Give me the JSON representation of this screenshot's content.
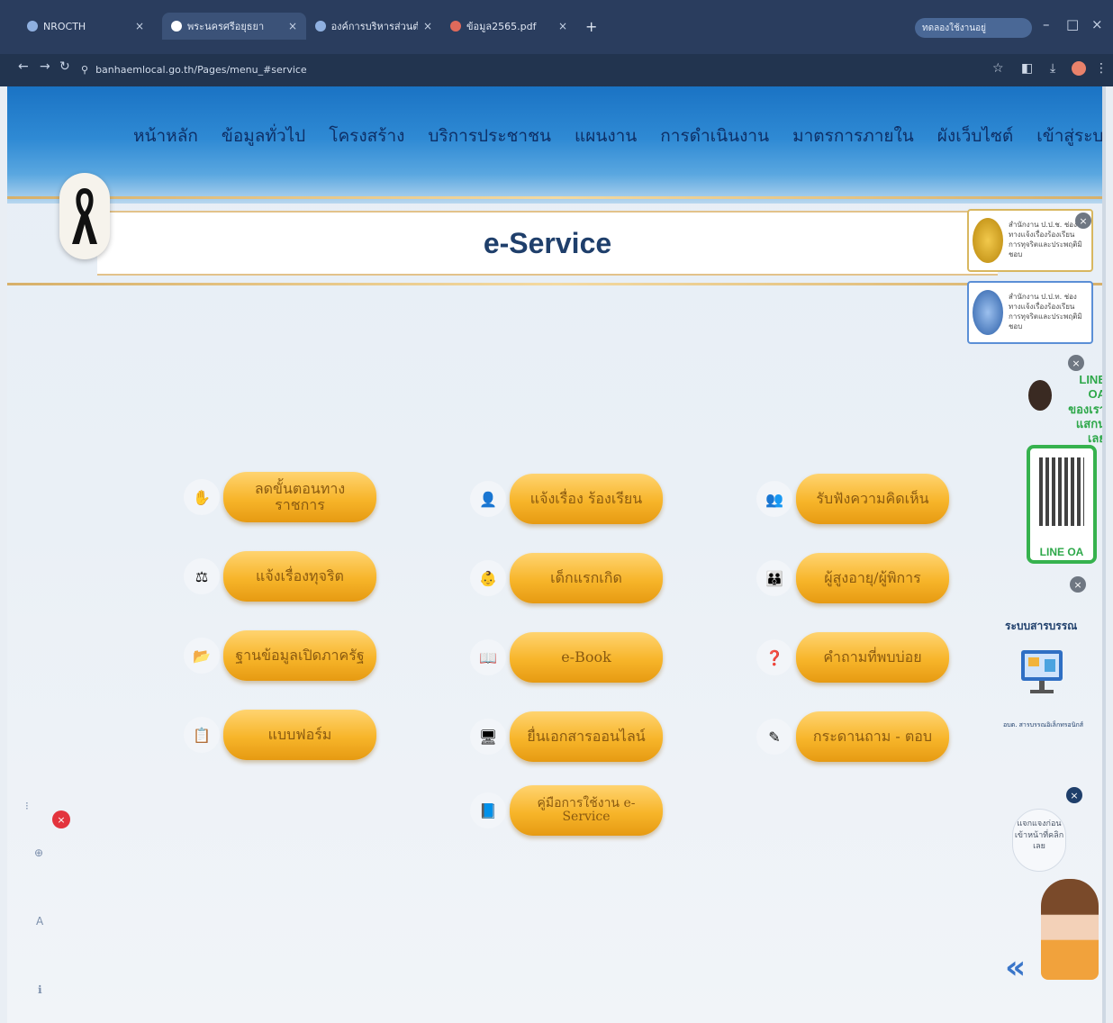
{
  "browser": {
    "tabs": [
      {
        "label": "NROCTH"
      },
      {
        "label": "พระนครศรีอยุธยา"
      },
      {
        "label": "องค์การบริหารส่วนตำบลบ้านแหลม"
      },
      {
        "label": "ข้อมูล2565.pdf"
      }
    ],
    "new_tab": "+",
    "profile_chip": "ทดลองใช้งานอยู่",
    "url": "banhaemlocal.go.th/Pages/menu_#service",
    "window_controls": {
      "minimize": "–",
      "maximize": "□",
      "close": "×"
    }
  },
  "nav": {
    "items": [
      "หน้าหลัก",
      "ข้อมูลทั่วไป",
      "โครงสร้าง",
      "บริการประชาชน",
      "แผนงาน",
      "การดำเนินงาน",
      "มาตรการภายใน",
      "ผังเว็บไซต์",
      "เข้าสู่ระบบ"
    ]
  },
  "page": {
    "title": "e-Service"
  },
  "services": {
    "col1": [
      {
        "label": "ลดขั้นตอนทางราชการ",
        "icon": "hands-icon"
      },
      {
        "label": "แจ้งเรื่องทุจริต",
        "icon": "scale-icon"
      },
      {
        "label": "ฐานข้อมูลเปิดภาครัฐ",
        "icon": "folder-icon"
      },
      {
        "label": "แบบฟอร์ม",
        "icon": "clipboard-icon"
      }
    ],
    "col2": [
      {
        "label": "แจ้งเรื่อง ร้องเรียน",
        "icon": "person-icon"
      },
      {
        "label": "เด็กแรกเกิด",
        "icon": "baby-icon"
      },
      {
        "label": "e-Book",
        "icon": "book-icon"
      },
      {
        "label": "ยื่นเอกสารออนไลน์",
        "icon": "monitor-icon"
      },
      {
        "label": "คู่มือการใช้งาน e-Service",
        "icon": "manual-icon"
      }
    ],
    "col3": [
      {
        "label": "รับฟังความคิดเห็น",
        "icon": "meeting-icon"
      },
      {
        "label": "ผู้สูงอายุ/ผู้พิการ",
        "icon": "family-icon"
      },
      {
        "label": "คำถามที่พบบ่อย",
        "icon": "faq-icon"
      },
      {
        "label": "กระดานถาม - ตอบ",
        "icon": "qa-icon"
      }
    ]
  },
  "side": {
    "card1": {
      "text": "สำนักงาน ป.ป.ช. ช่องทางแจ้งเรื่องร้องเรียน การทุจริตและประพฤติมิชอบ"
    },
    "card2": {
      "text": "สำนักงาน ป.ป.ท. ช่องทางแจ้งเรื่องร้องเรียน การทุจริตและประพฤติมิชอบ"
    },
    "line": {
      "l1": "LINE OA",
      "l2": "ของเรา",
      "l3": "แสกนเลย",
      "qr_label": "LINE OA"
    },
    "saraban": {
      "title": "ระบบสารบรรณ",
      "caption": "อบต. สารบรรณอิเล็กทรอนิกส์"
    },
    "helper": {
      "text": "แจกแจงก่อนเข้าหน้าที่คลิกเลย"
    },
    "close": "×",
    "chevron": "«"
  },
  "colors": {
    "header_blue": "#1a73c4",
    "button_gold": "#f7b52a",
    "menu_text": "#0e2f66"
  }
}
